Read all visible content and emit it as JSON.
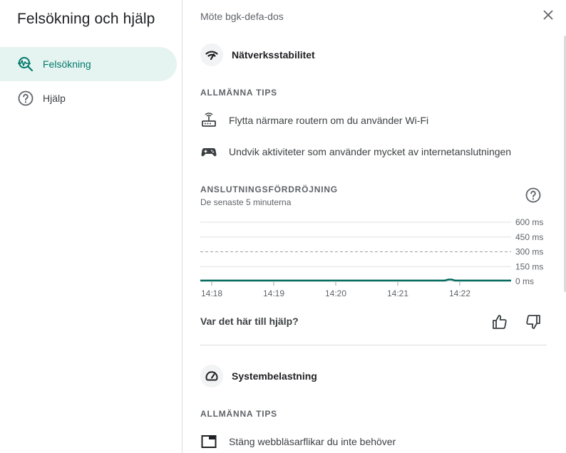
{
  "sidebar": {
    "title": "Felsökning och hjälp",
    "items": [
      {
        "label": "Felsökning",
        "icon": "troubleshoot-icon",
        "active": true
      },
      {
        "label": "Hjälp",
        "icon": "help-circle-icon",
        "active": false
      }
    ]
  },
  "main": {
    "meeting_label": "Möte bgk-defa-dos",
    "network": {
      "title": "Nätverksstabilitet",
      "tips_heading": "ALLMÄNNA TIPS",
      "tips": [
        {
          "icon": "router-icon",
          "text": "Flytta närmare routern om du använder Wi-Fi"
        },
        {
          "icon": "gamepad-icon",
          "text": "Undvik aktiviteter som använder mycket av internetanslutningen"
        }
      ],
      "latency_heading": "ANSLUTNINGSFÖRDRÖJNING",
      "latency_sub": "De senaste 5 minuterna"
    },
    "feedback_question": "Var det här till hjälp?",
    "system": {
      "title": "Systembelastning",
      "tips_heading": "ALLMÄNNA TIPS",
      "tips": [
        {
          "icon": "browser-tab-icon",
          "text": "Stäng webbläsarflikar du inte behöver"
        }
      ]
    }
  },
  "colors": {
    "accent": "#00796b",
    "active_bg": "#e6f4f1",
    "line": "#00695c"
  },
  "chart_data": {
    "type": "line",
    "x_ticks": [
      "14:18",
      "14:19",
      "14:20",
      "14:21",
      "14:22"
    ],
    "y_ticks": [
      "600 ms",
      "450 ms",
      "300 ms",
      "150 ms",
      "0 ms"
    ],
    "ylim": [
      0,
      600
    ],
    "unit": "ms",
    "threshold": 300,
    "series": [
      {
        "values": [
          8,
          8,
          8,
          8,
          8,
          8,
          8,
          8,
          8,
          8,
          8,
          8,
          8,
          8,
          8,
          8,
          8,
          8,
          8,
          8,
          8,
          8,
          8,
          8,
          8,
          8,
          8,
          8,
          8,
          8,
          8,
          8,
          8,
          8,
          8,
          8,
          8,
          8,
          8,
          8,
          8,
          8,
          8,
          8,
          8,
          8,
          8,
          8,
          8,
          8,
          8,
          8,
          8,
          8,
          8,
          8,
          8,
          8,
          8,
          8,
          8,
          8,
          8,
          8,
          8,
          8,
          8,
          8,
          8,
          8,
          8,
          18,
          18,
          8,
          8,
          8,
          8,
          8,
          8,
          8,
          8,
          8,
          8,
          8,
          8,
          8,
          8,
          8,
          8,
          8
        ]
      }
    ]
  }
}
